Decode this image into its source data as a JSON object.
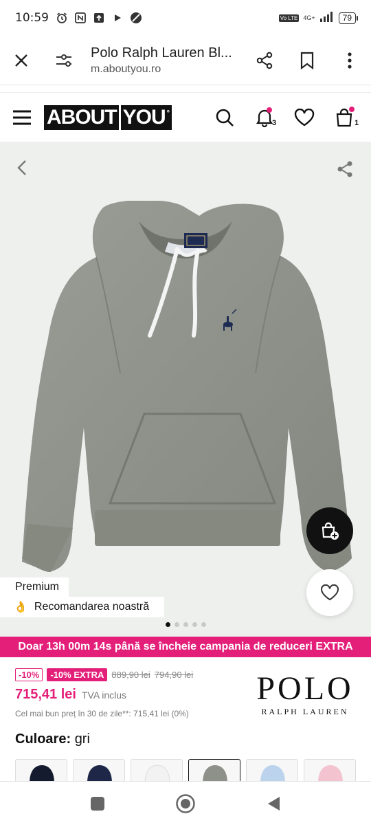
{
  "status_bar": {
    "time": "10:59",
    "battery": "79",
    "network": "4G+",
    "volte": "Vo LTE"
  },
  "browser": {
    "title": "Polo Ralph Lauren Bl...",
    "url": "m.aboutyou.ro",
    "icons": [
      "close-icon",
      "tune-icon",
      "share-icon",
      "bookmark-icon",
      "more-icon"
    ]
  },
  "site_header": {
    "logo_left": "ABOUT",
    "logo_right": "YOU",
    "notifications_count": "3",
    "cart_count": "1",
    "accent_color": "#e31f7a"
  },
  "gallery": {
    "tag_premium": "Premium",
    "tag_recommendation": "Recomandarea noastră",
    "tag_recommendation_emoji": "👌",
    "active_image_index": 0,
    "image_count": 5
  },
  "promo": {
    "text": "Doar 13h 00m 14s până se încheie campania de reduceri EXTRA"
  },
  "price": {
    "discount_pill": "-10%",
    "extra_pill": "-10% EXTRA",
    "old_price_1": "889,90 lei",
    "old_price_2": "794,90 lei",
    "current_price": "715,41 lei",
    "vat_note": "TVA inclus",
    "best_price_note": "Cel mai bun preț în 30 de zile**: 715,41 lei (0%)"
  },
  "brand": {
    "line1": "POLO",
    "line2": "RALPH LAUREN"
  },
  "color": {
    "label": "Culoare:",
    "value": "gri"
  },
  "swatches": [
    "navy",
    "dark-navy",
    "white",
    "grey",
    "light-blue",
    "pink"
  ]
}
